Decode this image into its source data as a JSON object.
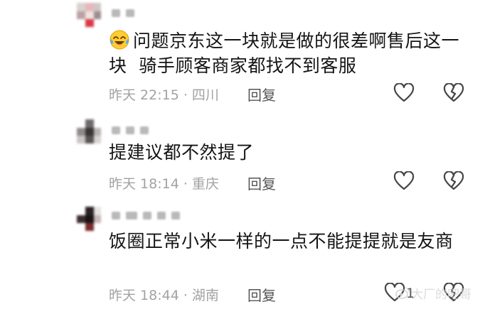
{
  "comments": [
    {
      "text": "问题京东这一块就是做的很差啊售后这一块  骑手顾客商家都找不到客服",
      "emoji": "laughing-crying-emoji",
      "meta": "昨天 22:15 · 四川",
      "reply_label": "回复"
    },
    {
      "text": "提建议都不然提了",
      "meta": "昨天 18:14 · 重庆",
      "reply_label": "回复"
    },
    {
      "text": "饭圈正常小米一样的一点不能提提就是友商",
      "meta": "昨天 18:44 · 湖南",
      "reply_label": "回复",
      "like_count": "1"
    }
  ],
  "icons": {
    "like": "heart-outline-icon",
    "dislike": "broken-heart-outline-icon"
  },
  "watermark": {
    "text": "大厂的吧哥"
  },
  "colors": {
    "text": "#141414",
    "meta": "#a2a2a2",
    "action": "#545454"
  }
}
